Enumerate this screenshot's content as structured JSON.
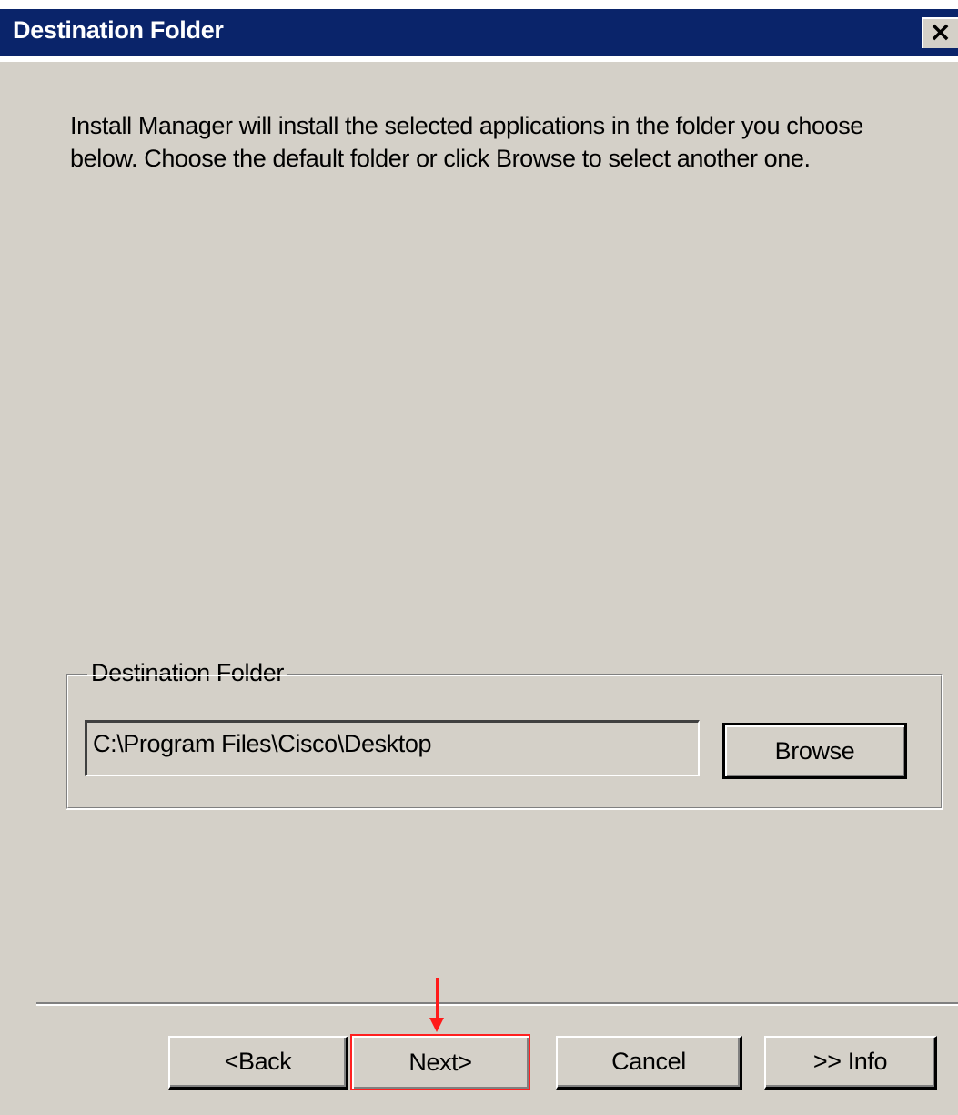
{
  "window": {
    "title": "Destination Folder",
    "close_glyph": "×"
  },
  "instruction": {
    "line1": "Install Manager will install the selected applications in the folder you choose",
    "line2": "below. Choose the default folder or click Browse to select another one."
  },
  "destination_group": {
    "legend": "Destination Folder",
    "path_value": "C:\\Program Files\\Cisco\\Desktop",
    "browse_label": "Browse"
  },
  "buttons": {
    "back_label": "<Back",
    "next_label": "Next>",
    "cancel_label": "Cancel",
    "info_label": ">> Info"
  },
  "annotation": {
    "highlight_color": "#ff1a1a",
    "target": "Next>"
  },
  "colors": {
    "titlebar": "#0a246a",
    "dialog_face": "#d4d0c8"
  }
}
